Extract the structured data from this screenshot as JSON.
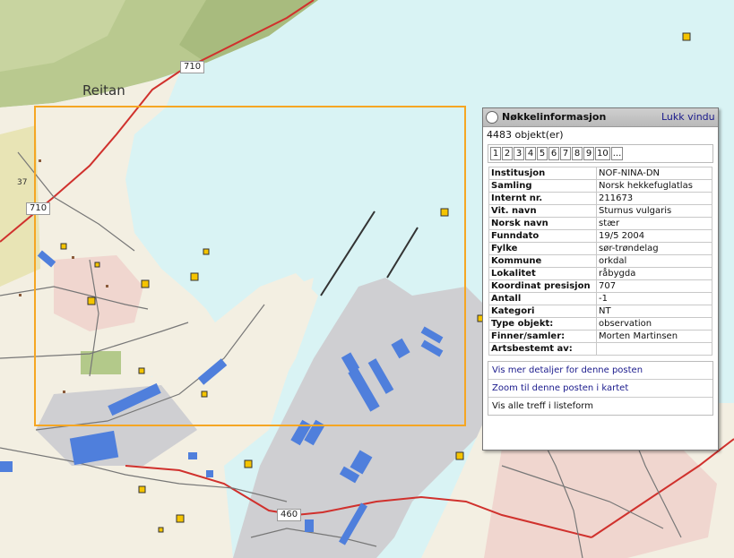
{
  "map": {
    "place_label": "Reitan",
    "road_numbers": [
      "710",
      "710",
      "37",
      "460"
    ],
    "colors": {
      "water": "#d9f3f4",
      "land": "#f3efe2",
      "forest": "#b9c98f",
      "industrial": "#cfcfd2",
      "building": "#4f7fdc",
      "road_main": "#d0312d",
      "selection": "#f5a623",
      "marker": "#f5c400"
    }
  },
  "popup": {
    "title": "Nøkkelinformasjon",
    "close_label": "Lukk vindu",
    "object_count": "4483 objekt(er)",
    "pager": [
      "1",
      "2",
      "3",
      "4",
      "5",
      "6",
      "7",
      "8",
      "9",
      "10",
      "..."
    ],
    "fields": [
      {
        "key": "Institusjon",
        "value": "NOF-NINA-DN"
      },
      {
        "key": "Samling",
        "value": "Norsk hekkefuglatlas"
      },
      {
        "key": "Internt nr.",
        "value": "211673"
      },
      {
        "key": "Vit. navn",
        "value": "Sturnus vulgaris"
      },
      {
        "key": "Norsk navn",
        "value": "stær"
      },
      {
        "key": "Funndato",
        "value": "19/5 2004"
      },
      {
        "key": "Fylke",
        "value": "sør-trøndelag"
      },
      {
        "key": "Kommune",
        "value": "orkdal"
      },
      {
        "key": "Lokalitet",
        "value": "råbygda"
      },
      {
        "key": "Koordinat presisjon",
        "value": "707"
      },
      {
        "key": "Antall",
        "value": "-1"
      },
      {
        "key": "Kategori",
        "value": "NT"
      },
      {
        "key": "Type objekt:",
        "value": "observation"
      },
      {
        "key": "Finner/samler:",
        "value": "Morten Martinsen"
      },
      {
        "key": "Artsbestemt av:",
        "value": ""
      }
    ],
    "links": [
      "Vis mer detaljer for denne posten",
      "Zoom til denne posten i kartet",
      "Vis alle treff i listeform"
    ]
  }
}
